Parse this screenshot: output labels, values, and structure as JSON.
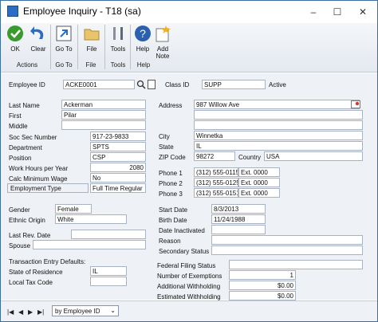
{
  "window": {
    "title": "Employee Inquiry  -  T18 (sa)",
    "minimize": "–",
    "maximize": "☐",
    "close": "✕"
  },
  "ribbon": {
    "ok": "OK",
    "clear": "Clear",
    "goto": "Go To",
    "file": "File",
    "tools": "Tools",
    "help": "Help",
    "add_note_1": "Add",
    "add_note_2": "Note",
    "group_actions": "Actions",
    "group_goto": "Go To",
    "group_file": "File",
    "group_tools": "Tools",
    "group_help": "Help"
  },
  "header": {
    "employee_id_label": "Employee ID",
    "employee_id": "ACKE0001",
    "class_id_label": "Class ID",
    "class_id": "SUPP",
    "status": "Active"
  },
  "personal": {
    "last_name_label": "Last Name",
    "last_name": "Ackerman",
    "first_label": "First",
    "first": "Pilar",
    "middle_label": "Middle",
    "middle": "",
    "ssn_label": "Soc Sec Number",
    "ssn": "917-23-9833",
    "department_label": "Department",
    "department": "SPTS",
    "position_label": "Position",
    "position": "CSP",
    "work_hours_label": "Work Hours per Year",
    "work_hours": "2080",
    "calc_min_wage_label": "Calc Minimum Wage",
    "calc_min_wage": "No",
    "employment_type_label": "Employment Type",
    "employment_type": "Full Time Regular",
    "gender_label": "Gender",
    "gender": "Female",
    "ethnic_label": "Ethnic Origin",
    "ethnic": "White",
    "last_rev_label": "Last Rev. Date",
    "last_rev": "",
    "spouse_label": "Spouse",
    "spouse": "",
    "trx_defaults_label": "Transaction Entry Defaults:",
    "state_res_label": "State of Residence",
    "state_res": "IL",
    "local_tax_label": "Local Tax Code",
    "local_tax": ""
  },
  "address": {
    "address_label": "Address",
    "line1": "987 Willow Ave",
    "line2": "",
    "line3": "",
    "city_label": "City",
    "city": "Winnetka",
    "state_label": "State",
    "state": "IL",
    "zip_label": "ZIP Code",
    "zip": "98272",
    "country_label": "Country",
    "country": "USA",
    "phone1_label": "Phone 1",
    "phone1": "(312) 555-0115",
    "ext1": "Ext. 0000",
    "phone2_label": "Phone 2",
    "phone2": "(312) 555-0125",
    "ext2": "Ext. 0000",
    "phone3_label": "Phone 3",
    "phone3": "(312) 555-0151",
    "ext3": "Ext. 0000",
    "start_label": "Start Date",
    "start": "8/3/2013",
    "birth_label": "Birth Date",
    "birth": "11/24/1988",
    "inactivated_label": "Date Inactivated",
    "inactivated": "",
    "reason_label": "Reason",
    "reason": "",
    "secondary_label": "Secondary Status",
    "secondary": "",
    "federal_label": "Federal Filing Status",
    "federal": "",
    "exemptions_label": "Number of Exemptions",
    "exemptions": "1",
    "add_with_label": "Additional Withholding",
    "add_with": "$0.00",
    "est_with_label": "Estimated Withholding",
    "est_with": "$0.00"
  },
  "bottom": {
    "first": "|◀",
    "prev": "◀",
    "next": "▶",
    "last": "▶|",
    "sort": "by Employee ID"
  }
}
